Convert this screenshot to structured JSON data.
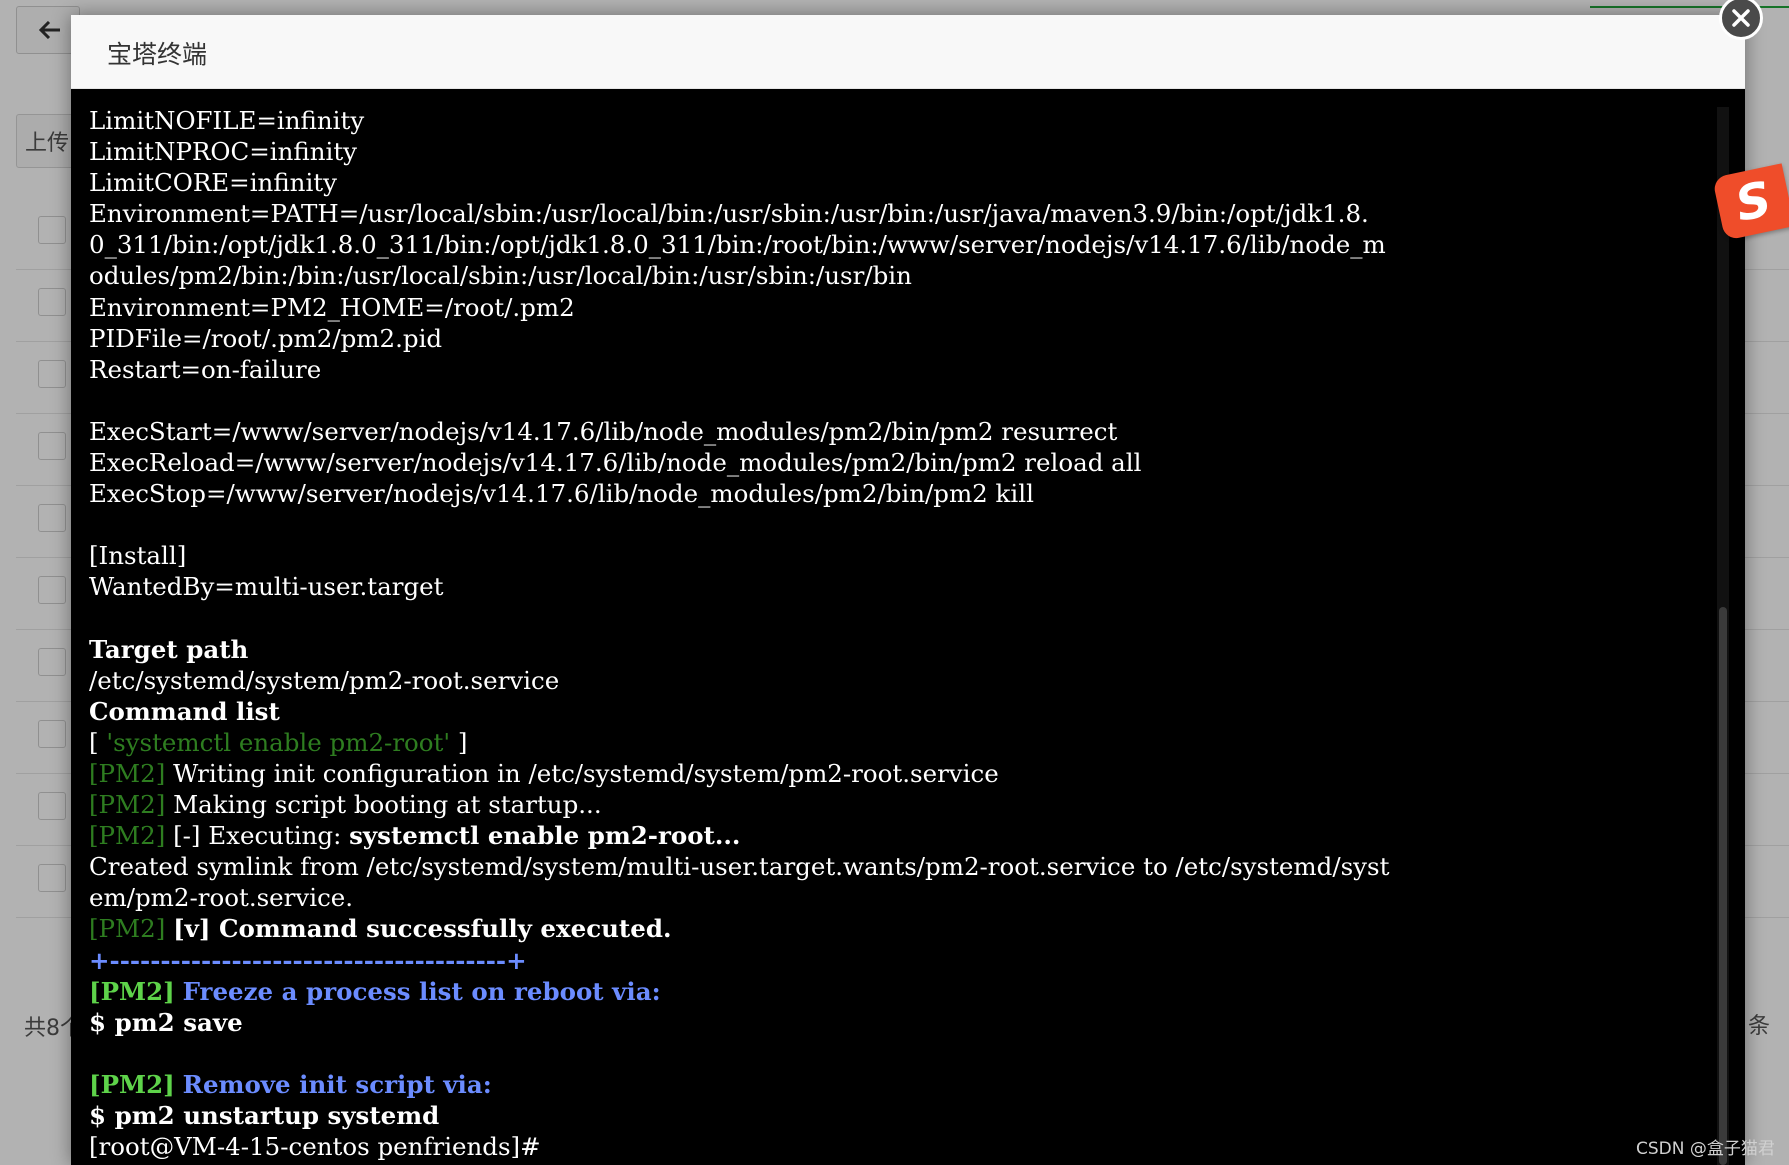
{
  "modal": {
    "title": "宝塔终端"
  },
  "background": {
    "upload_label": "上传",
    "footer_left": "共8个",
    "footer_right": "条"
  },
  "terminal_lines": [
    [
      {
        "t": "LimitNOFILE=infinity"
      }
    ],
    [
      {
        "t": "LimitNPROC=infinity"
      }
    ],
    [
      {
        "t": "LimitCORE=infinity"
      }
    ],
    [
      {
        "t": "Environment=PATH=/usr/local/sbin:/usr/local/bin:/usr/sbin:/usr/bin:/usr/java/maven3.9/bin:/opt/jdk1.8."
      }
    ],
    [
      {
        "t": "0_311/bin:/opt/jdk1.8.0_311/bin:/opt/jdk1.8.0_311/bin:/root/bin:/www/server/nodejs/v14.17.6/lib/node_m"
      }
    ],
    [
      {
        "t": "odules/pm2/bin:/bin:/usr/local/sbin:/usr/local/bin:/usr/sbin:/usr/bin"
      }
    ],
    [
      {
        "t": "Environment=PM2_HOME=/root/.pm2"
      }
    ],
    [
      {
        "t": "PIDFile=/root/.pm2/pm2.pid"
      }
    ],
    [
      {
        "t": "Restart=on-failure"
      }
    ],
    [
      {
        "t": ""
      }
    ],
    [
      {
        "t": "ExecStart=/www/server/nodejs/v14.17.6/lib/node_modules/pm2/bin/pm2 resurrect"
      }
    ],
    [
      {
        "t": "ExecReload=/www/server/nodejs/v14.17.6/lib/node_modules/pm2/bin/pm2 reload all"
      }
    ],
    [
      {
        "t": "ExecStop=/www/server/nodejs/v14.17.6/lib/node_modules/pm2/bin/pm2 kill"
      }
    ],
    [
      {
        "t": ""
      }
    ],
    [
      {
        "t": "[Install]"
      }
    ],
    [
      {
        "t": "WantedBy=multi-user.target"
      }
    ],
    [
      {
        "t": ""
      }
    ],
    [
      {
        "t": "Target path",
        "c": "b"
      }
    ],
    [
      {
        "t": "/etc/systemd/system/pm2-root.service"
      }
    ],
    [
      {
        "t": "Command list",
        "c": "b"
      }
    ],
    [
      {
        "t": "[ "
      },
      {
        "t": "'systemctl enable pm2-root'",
        "c": "dg"
      },
      {
        "t": " ]"
      }
    ],
    [
      {
        "t": "[PM2]",
        "c": "dg"
      },
      {
        "t": " Writing init configuration in /etc/systemd/system/pm2-root.service"
      }
    ],
    [
      {
        "t": "[PM2]",
        "c": "dg"
      },
      {
        "t": " Making script booting at startup..."
      }
    ],
    [
      {
        "t": "[PM2]",
        "c": "dg"
      },
      {
        "t": " [-] Executing: "
      },
      {
        "t": "systemctl enable pm2-root...",
        "c": "b"
      }
    ],
    [
      {
        "t": "Created symlink from /etc/systemd/system/multi-user.target.wants/pm2-root.service to /etc/systemd/syst"
      }
    ],
    [
      {
        "t": "em/pm2-root.service."
      }
    ],
    [
      {
        "t": "[PM2]",
        "c": "dg"
      },
      {
        "t": " "
      },
      {
        "t": "[v] Command successfully executed.",
        "c": "b"
      }
    ],
    [
      {
        "t": "+---------------------------------------+",
        "c": "bl"
      }
    ],
    [
      {
        "t": "[PM2]",
        "c": "bg"
      },
      {
        "t": " "
      },
      {
        "t": "Freeze a process list on reboot via:",
        "c": "bl"
      }
    ],
    [
      {
        "t": "$ pm2 save",
        "c": "b"
      }
    ],
    [
      {
        "t": ""
      }
    ],
    [
      {
        "t": "[PM2]",
        "c": "bg"
      },
      {
        "t": " "
      },
      {
        "t": "Remove init script via:",
        "c": "bl"
      }
    ],
    [
      {
        "t": "$ pm2 unstartup systemd",
        "c": "b"
      }
    ],
    [
      {
        "t": "[root@VM-4-15-centos penfriends]#"
      }
    ]
  ],
  "sogou_badge": "S",
  "watermark": "CSDN @盒子猫君",
  "colors": {
    "terminal_bg": "#000000",
    "pm2_tag_dim": "#2e7d20",
    "pm2_tag_bright": "#5ed34a",
    "hint_blue": "#6b8cff",
    "close_button": "#4a4a4a",
    "sogou": "#ef4d2a"
  },
  "icons": {
    "back": "arrow-left-icon",
    "close": "close-icon",
    "ime": "sogou-ime-icon"
  }
}
